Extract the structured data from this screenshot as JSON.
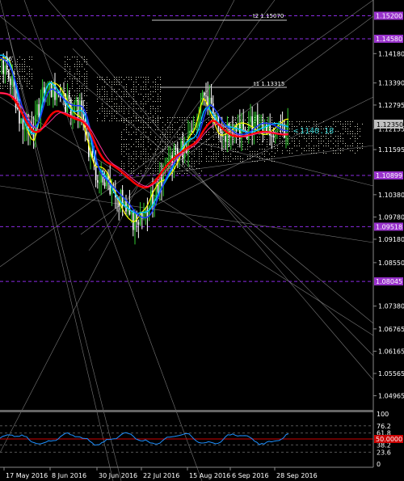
{
  "colors": {
    "background": "#000000",
    "grid_level": "#8a2be2",
    "bull_candle": "#32cd32",
    "bear_candle": "#ffffff",
    "ma_yellow": "#ffff00",
    "ma_cyan": "#00bfff",
    "ma_red": "#ff0000",
    "ma_blue": "#1e3cff",
    "ma_magenta": "#ff3399",
    "cloud_dots": "#d8d8c8",
    "trend_lines": "#c8c8c8",
    "rsi_line": "#1e90ff",
    "current_price_tag": "#c0c0c0",
    "level_tag": "#9932cc"
  },
  "price_axis": {
    "ticks": [
      "1.14180",
      "1.13390",
      "1.12795",
      "1.12155",
      "1.11595",
      "1.10380",
      "1.09780",
      "1.09180",
      "1.08550",
      "1.07380",
      "1.06765",
      "1.06165",
      "1.05565",
      "1.04965"
    ],
    "levels": [
      {
        "name": "level-15200",
        "label": "1.15200"
      },
      {
        "name": "level-14580",
        "label": "1.14580"
      },
      {
        "name": "level-10899",
        "label": "1.10899"
      },
      {
        "name": "level-09518",
        "label": "1.09518"
      },
      {
        "name": "level-08045",
        "label": "1.08045"
      }
    ],
    "current_price": "1.12350"
  },
  "time_axis": {
    "labels": [
      "17 May 2016",
      "8 Jun 2016",
      "30 Jun 2016",
      "22 Jul 2016",
      "15 Aug 2016",
      "6 Sep 2016",
      "28 Sep 2016"
    ]
  },
  "annotations": {
    "t2": "t2 1.15070",
    "t1": "t1 1.13315",
    "cursor_readout": "1140.18",
    "top_left_fragment": "36"
  },
  "rsi_axis": {
    "ticks": [
      "100",
      "76.2",
      "61.8",
      "50.0",
      "38.2",
      "23.6",
      "0"
    ],
    "highlight": "50.0000"
  },
  "chart_data": {
    "type": "candlestick",
    "symbol_price_range": [
      1.0465,
      1.1545
    ],
    "levels": [
      1.152,
      1.1458,
      1.10899,
      1.09518,
      1.08045
    ],
    "current_price": 1.1235,
    "fib_targets": {
      "t1": 1.13315,
      "t2": 1.1507
    },
    "rsi_levels": [
      100,
      76.2,
      61.8,
      50.0,
      38.2,
      23.6,
      0
    ]
  }
}
